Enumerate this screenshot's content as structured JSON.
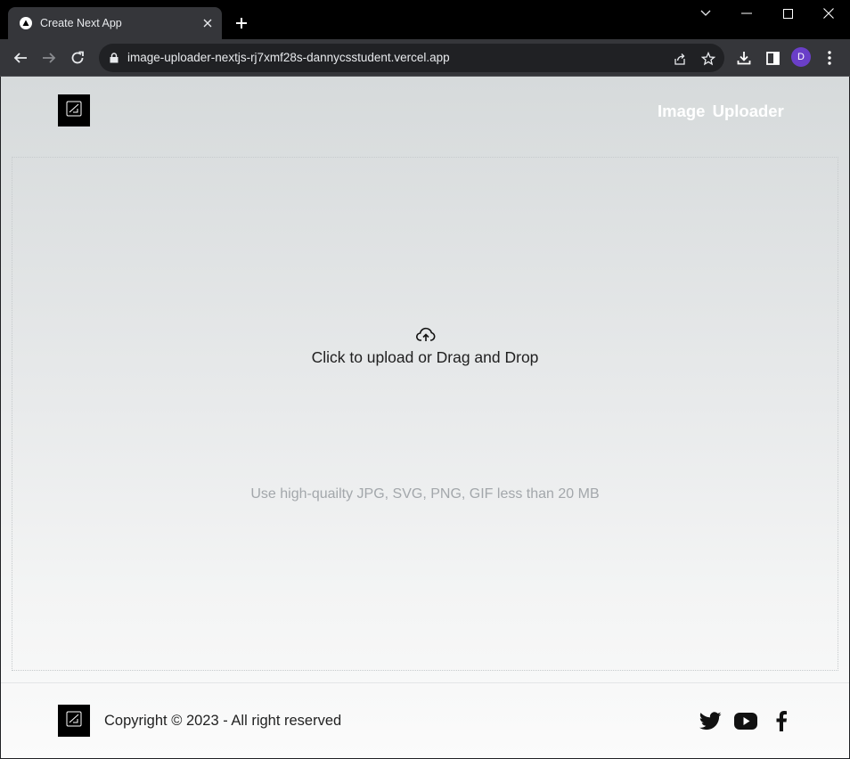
{
  "browser": {
    "tab_title": "Create Next App",
    "url": "image-uploader-nextjs-rj7xmf28s-dannycsstudent.vercel.app",
    "profile_initial": "D",
    "profile_color": "#6a3fc8"
  },
  "header": {
    "brand_title": "Image Uploader"
  },
  "uploader": {
    "prompt": "Click to upload or Drag and Drop",
    "hint": "Use high-quailty JPG, SVG, PNG, GIF less than 20 MB"
  },
  "footer": {
    "copyright": "Copyright © 2023 - All right reserved",
    "social": [
      "twitter-icon",
      "youtube-icon",
      "facebook-icon"
    ]
  }
}
